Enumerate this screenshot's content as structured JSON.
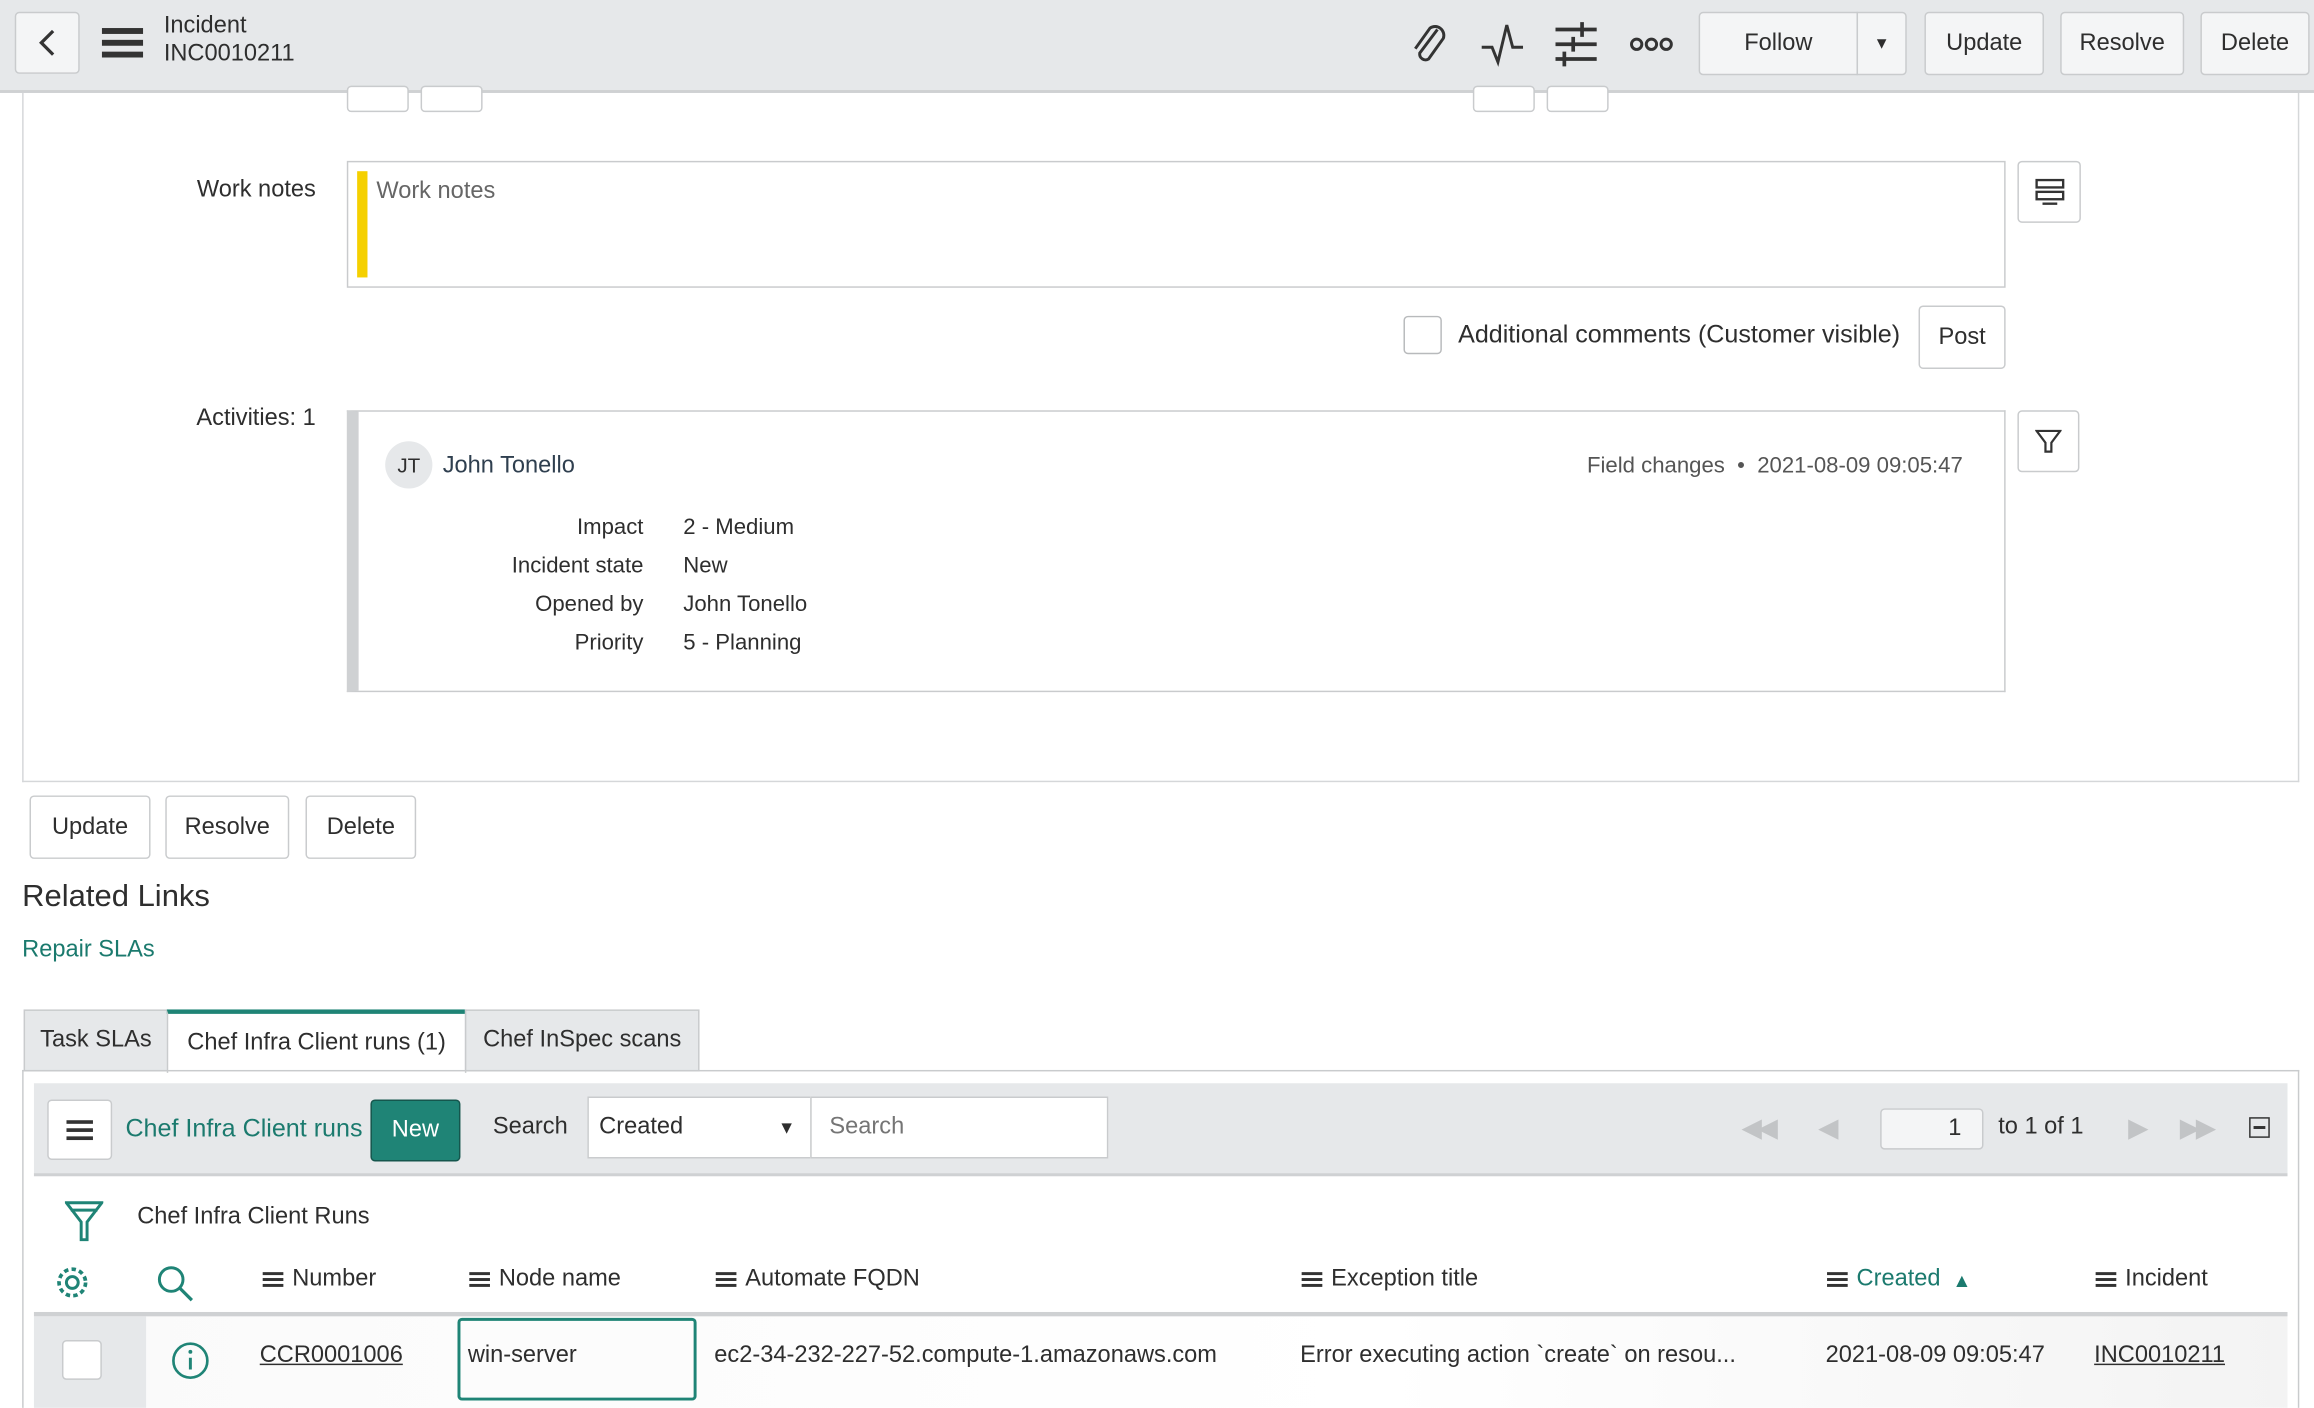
{
  "header": {
    "title": "Incident",
    "number": "INC0010211",
    "follow": "Follow",
    "update": "Update",
    "resolve": "Resolve",
    "delete": "Delete",
    "icons": [
      "back-icon",
      "menu-icon",
      "paperclip-icon",
      "activity-icon",
      "settings-sliders-icon",
      "more-icon",
      "caret-down-icon"
    ]
  },
  "form": {
    "work_notes_label": "Work notes",
    "work_notes_placeholder": "Work notes",
    "additional_comments_label": "Additional comments (Customer visible)",
    "post": "Post",
    "activities_label": "Activities: 1",
    "activity": {
      "initials": "JT",
      "user": "John Tonello",
      "type": "Field changes",
      "separator": "•",
      "timestamp": "2021-08-09 09:05:47",
      "changes": [
        {
          "field": "Impact",
          "value": "2 - Medium"
        },
        {
          "field": "Incident state",
          "value": "New"
        },
        {
          "field": "Opened by",
          "value": "John Tonello"
        },
        {
          "field": "Priority",
          "value": "5 - Planning"
        }
      ]
    }
  },
  "actions": {
    "update": "Update",
    "resolve": "Resolve",
    "delete": "Delete"
  },
  "related_links": {
    "title": "Related Links",
    "repair": "Repair SLAs"
  },
  "tabs": [
    {
      "label": "Task SLAs"
    },
    {
      "label": "Chef Infra Client runs (1)",
      "active": true
    },
    {
      "label": "Chef InSpec scans"
    }
  ],
  "list": {
    "title": "Chef Infra Client runs",
    "new": "New",
    "search_label": "Search",
    "search_field": "Created",
    "search_placeholder": "Search",
    "page": "1",
    "page_of": "to 1 of 1",
    "breadcrumb": "Chef Infra Client Runs",
    "columns": [
      "Number",
      "Node name",
      "Automate FQDN",
      "Exception title",
      "Created",
      "Incident"
    ],
    "sort_column": "Created",
    "sort_dir": "ascending",
    "rows": [
      {
        "number": "CCR0001006",
        "node": "win-server",
        "fqdn": "ec2-34-232-227-52.compute-1.amazonaws.com",
        "exception": "Error executing action `create` on resou...",
        "created": "2021-08-09 09:05:47",
        "incident": "INC0010211"
      }
    ]
  },
  "colors": {
    "accent": "#1f8476",
    "work_notes_bar": "#f5d000",
    "header_bg": "#e6e8ea"
  }
}
